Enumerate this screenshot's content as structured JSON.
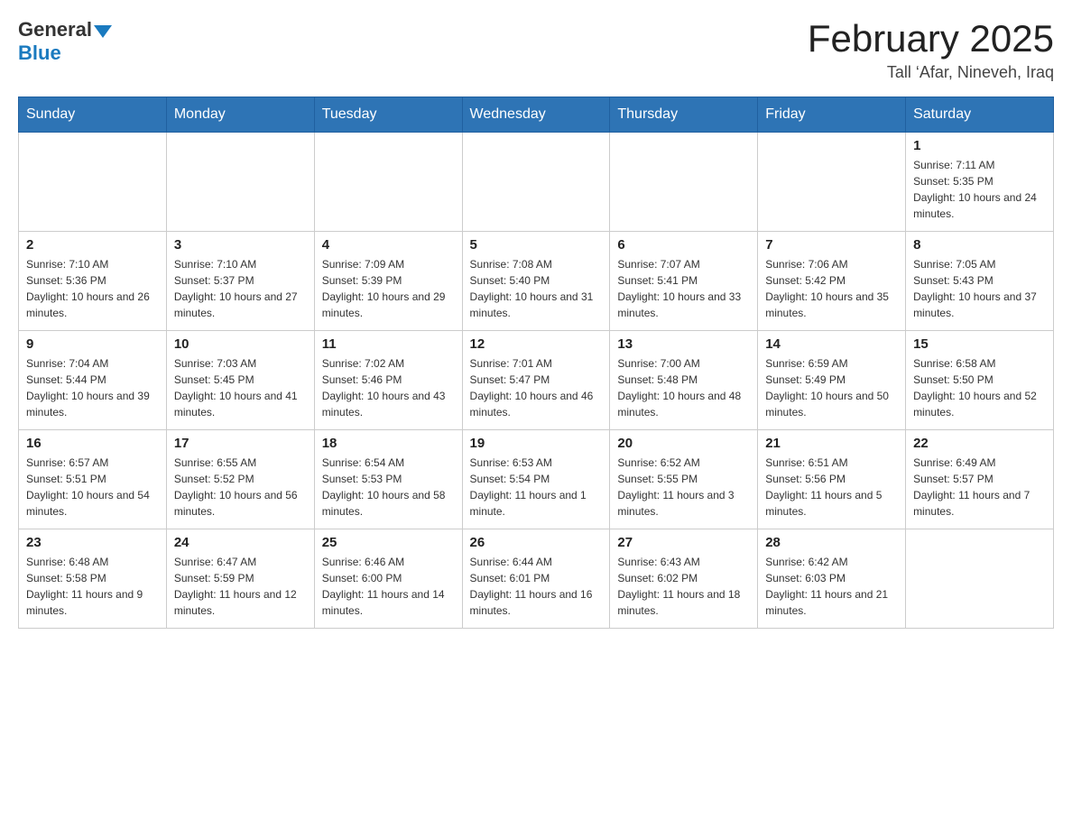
{
  "header": {
    "logo_general": "General",
    "logo_blue": "Blue",
    "title": "February 2025",
    "subtitle": "Tall ‘Afar, Nineveh, Iraq"
  },
  "days_of_week": [
    "Sunday",
    "Monday",
    "Tuesday",
    "Wednesday",
    "Thursday",
    "Friday",
    "Saturday"
  ],
  "weeks": [
    [
      {
        "day": "",
        "info": ""
      },
      {
        "day": "",
        "info": ""
      },
      {
        "day": "",
        "info": ""
      },
      {
        "day": "",
        "info": ""
      },
      {
        "day": "",
        "info": ""
      },
      {
        "day": "",
        "info": ""
      },
      {
        "day": "1",
        "info": "Sunrise: 7:11 AM\nSunset: 5:35 PM\nDaylight: 10 hours and 24 minutes."
      }
    ],
    [
      {
        "day": "2",
        "info": "Sunrise: 7:10 AM\nSunset: 5:36 PM\nDaylight: 10 hours and 26 minutes."
      },
      {
        "day": "3",
        "info": "Sunrise: 7:10 AM\nSunset: 5:37 PM\nDaylight: 10 hours and 27 minutes."
      },
      {
        "day": "4",
        "info": "Sunrise: 7:09 AM\nSunset: 5:39 PM\nDaylight: 10 hours and 29 minutes."
      },
      {
        "day": "5",
        "info": "Sunrise: 7:08 AM\nSunset: 5:40 PM\nDaylight: 10 hours and 31 minutes."
      },
      {
        "day": "6",
        "info": "Sunrise: 7:07 AM\nSunset: 5:41 PM\nDaylight: 10 hours and 33 minutes."
      },
      {
        "day": "7",
        "info": "Sunrise: 7:06 AM\nSunset: 5:42 PM\nDaylight: 10 hours and 35 minutes."
      },
      {
        "day": "8",
        "info": "Sunrise: 7:05 AM\nSunset: 5:43 PM\nDaylight: 10 hours and 37 minutes."
      }
    ],
    [
      {
        "day": "9",
        "info": "Sunrise: 7:04 AM\nSunset: 5:44 PM\nDaylight: 10 hours and 39 minutes."
      },
      {
        "day": "10",
        "info": "Sunrise: 7:03 AM\nSunset: 5:45 PM\nDaylight: 10 hours and 41 minutes."
      },
      {
        "day": "11",
        "info": "Sunrise: 7:02 AM\nSunset: 5:46 PM\nDaylight: 10 hours and 43 minutes."
      },
      {
        "day": "12",
        "info": "Sunrise: 7:01 AM\nSunset: 5:47 PM\nDaylight: 10 hours and 46 minutes."
      },
      {
        "day": "13",
        "info": "Sunrise: 7:00 AM\nSunset: 5:48 PM\nDaylight: 10 hours and 48 minutes."
      },
      {
        "day": "14",
        "info": "Sunrise: 6:59 AM\nSunset: 5:49 PM\nDaylight: 10 hours and 50 minutes."
      },
      {
        "day": "15",
        "info": "Sunrise: 6:58 AM\nSunset: 5:50 PM\nDaylight: 10 hours and 52 minutes."
      }
    ],
    [
      {
        "day": "16",
        "info": "Sunrise: 6:57 AM\nSunset: 5:51 PM\nDaylight: 10 hours and 54 minutes."
      },
      {
        "day": "17",
        "info": "Sunrise: 6:55 AM\nSunset: 5:52 PM\nDaylight: 10 hours and 56 minutes."
      },
      {
        "day": "18",
        "info": "Sunrise: 6:54 AM\nSunset: 5:53 PM\nDaylight: 10 hours and 58 minutes."
      },
      {
        "day": "19",
        "info": "Sunrise: 6:53 AM\nSunset: 5:54 PM\nDaylight: 11 hours and 1 minute."
      },
      {
        "day": "20",
        "info": "Sunrise: 6:52 AM\nSunset: 5:55 PM\nDaylight: 11 hours and 3 minutes."
      },
      {
        "day": "21",
        "info": "Sunrise: 6:51 AM\nSunset: 5:56 PM\nDaylight: 11 hours and 5 minutes."
      },
      {
        "day": "22",
        "info": "Sunrise: 6:49 AM\nSunset: 5:57 PM\nDaylight: 11 hours and 7 minutes."
      }
    ],
    [
      {
        "day": "23",
        "info": "Sunrise: 6:48 AM\nSunset: 5:58 PM\nDaylight: 11 hours and 9 minutes."
      },
      {
        "day": "24",
        "info": "Sunrise: 6:47 AM\nSunset: 5:59 PM\nDaylight: 11 hours and 12 minutes."
      },
      {
        "day": "25",
        "info": "Sunrise: 6:46 AM\nSunset: 6:00 PM\nDaylight: 11 hours and 14 minutes."
      },
      {
        "day": "26",
        "info": "Sunrise: 6:44 AM\nSunset: 6:01 PM\nDaylight: 11 hours and 16 minutes."
      },
      {
        "day": "27",
        "info": "Sunrise: 6:43 AM\nSunset: 6:02 PM\nDaylight: 11 hours and 18 minutes."
      },
      {
        "day": "28",
        "info": "Sunrise: 6:42 AM\nSunset: 6:03 PM\nDaylight: 11 hours and 21 minutes."
      },
      {
        "day": "",
        "info": ""
      }
    ]
  ]
}
